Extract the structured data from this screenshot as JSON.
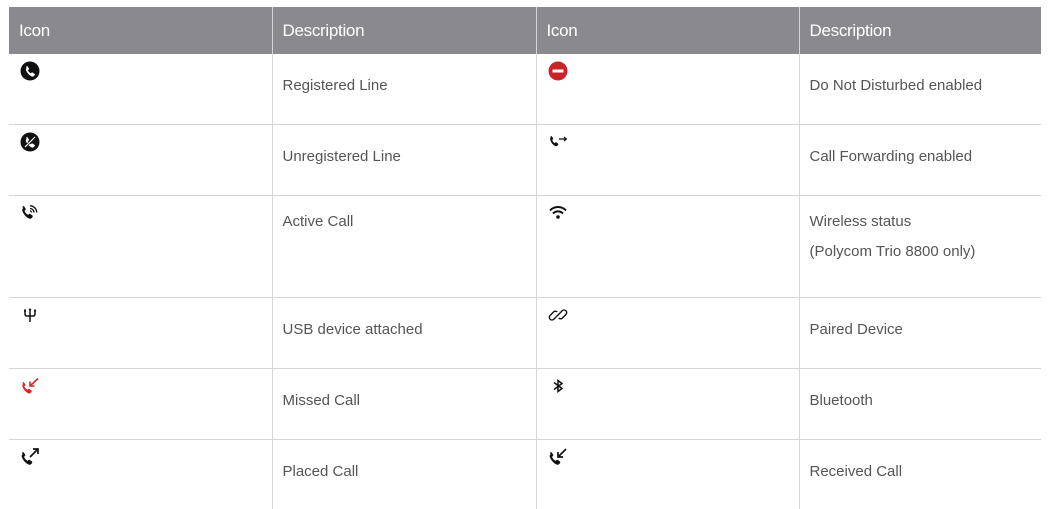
{
  "header": {
    "col1": "Icon",
    "col2": "Description",
    "col3": "Icon",
    "col4": "Description"
  },
  "rows": [
    {
      "left_icon": "registered-line-icon",
      "left_desc": "Registered Line",
      "right_icon": "do-not-disturb-icon",
      "right_desc": "Do Not Disturbed enabled"
    },
    {
      "left_icon": "unregistered-line-icon",
      "left_desc": "Unregistered Line",
      "right_icon": "call-forwarding-icon",
      "right_desc": "Call Forwarding enabled"
    },
    {
      "left_icon": "active-call-icon",
      "left_desc": "Active Call",
      "right_icon": "wireless-status-icon",
      "right_desc": "Wireless status",
      "right_desc2": "(Polycom Trio 8800 only)"
    },
    {
      "left_icon": "usb-icon",
      "left_desc": "USB device attached",
      "right_icon": "paired-device-icon",
      "right_desc": "Paired Device"
    },
    {
      "left_icon": "missed-call-icon",
      "left_desc": "Missed Call",
      "right_icon": "bluetooth-icon",
      "right_desc": "Bluetooth"
    },
    {
      "left_icon": "placed-call-icon",
      "left_desc": "Placed Call",
      "right_icon": "received-call-icon",
      "right_desc": "Received Call"
    }
  ],
  "colors": {
    "header_bg": "#8a8a8e",
    "header_text": "#ffffff",
    "body_text": "#555555",
    "icon_dark": "#111111",
    "dnd_red": "#cc2229",
    "missed_red": "#e02020",
    "border": "#d6d6d6"
  }
}
